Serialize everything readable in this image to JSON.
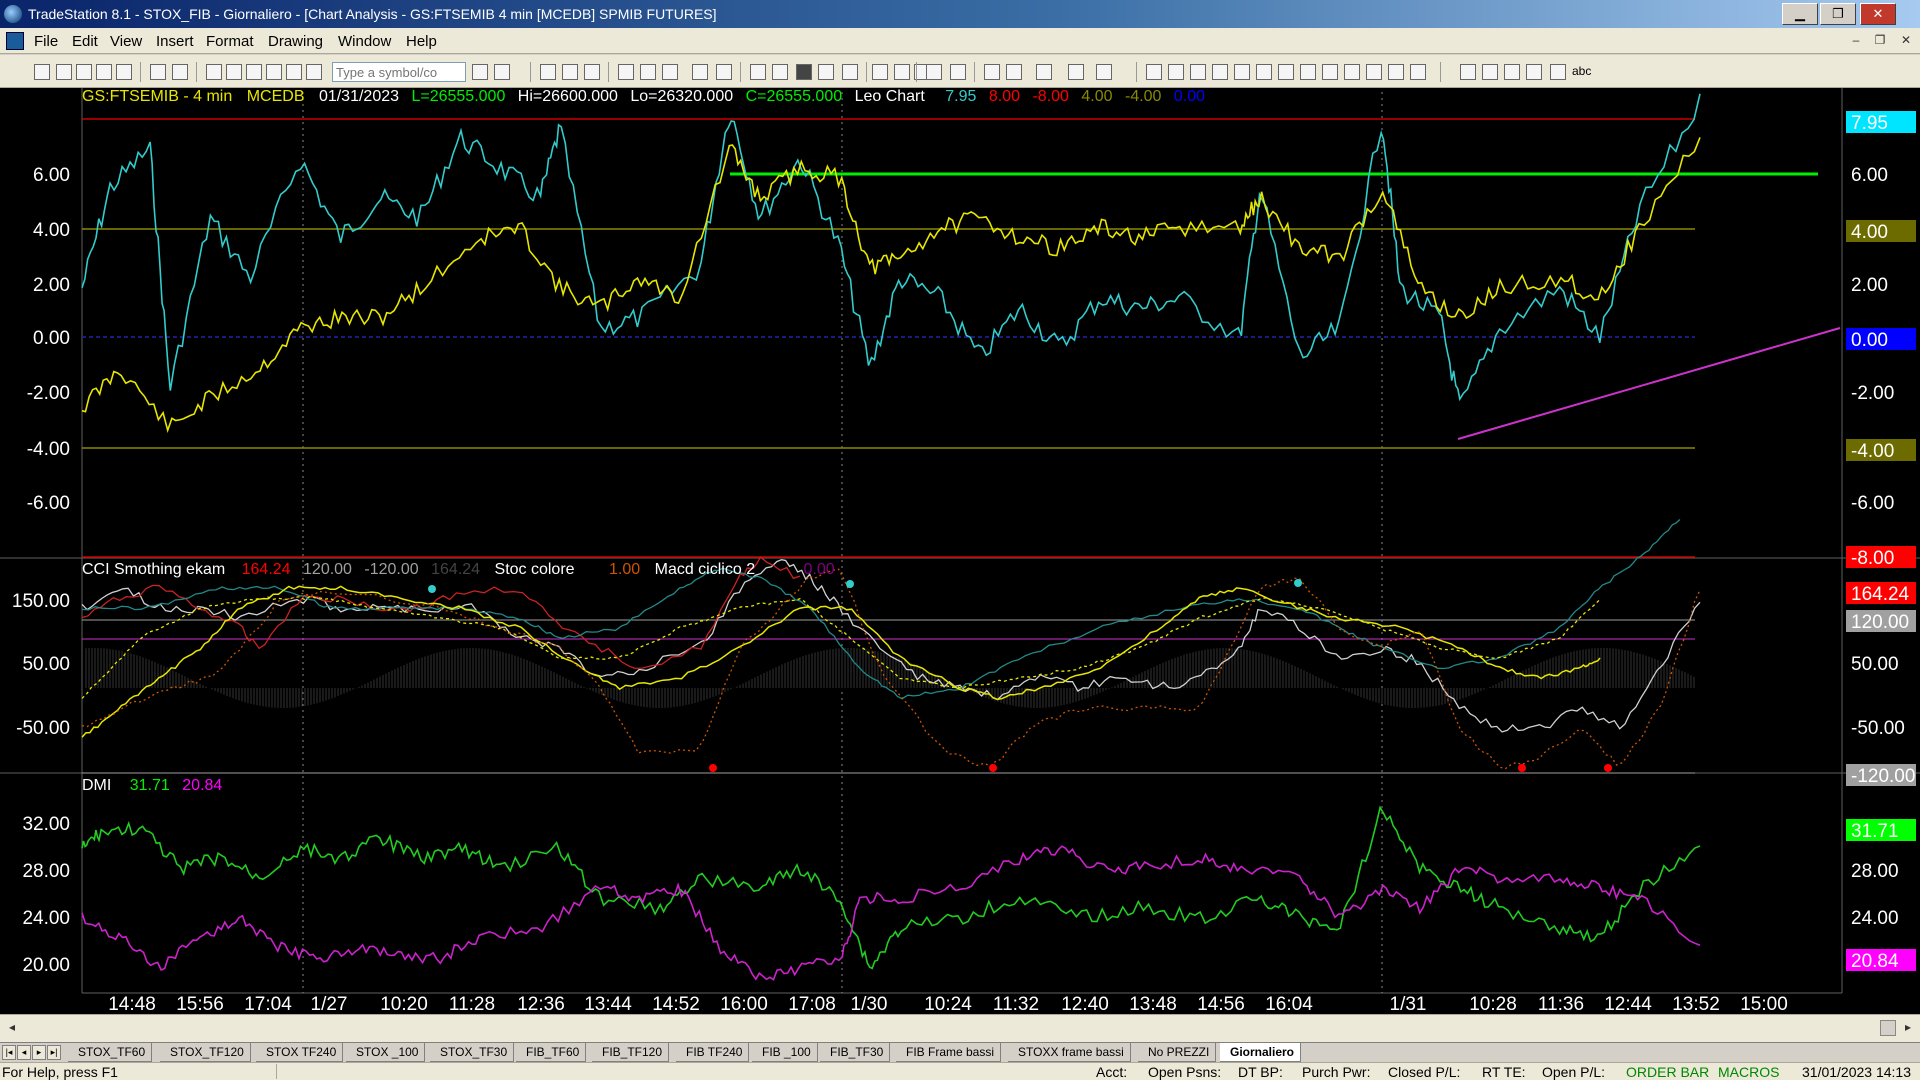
{
  "window": {
    "title": "TradeStation 8.1 - STOX_FIB - Giornaliero - [Chart Analysis - GS:FTSEMIB  4 min  [MCEDB] SPMIB FUTURES]",
    "minimize": "▁",
    "restore": "❐",
    "close": "✕"
  },
  "menu": {
    "items": [
      "File",
      "Edit",
      "View",
      "Insert",
      "Format",
      "Drawing",
      "Window",
      "Help"
    ],
    "mdi_minimize": "–",
    "mdi_restore": "❐",
    "mdi_close": "✕"
  },
  "toolbar": {
    "symbol_placeholder": "Type a symbol/co",
    "abc_label": "abc"
  },
  "chart": {
    "header": {
      "symbol": "GS:FTSEMIB - 4 min",
      "exchange": "MCEDB",
      "date": "01/31/2023",
      "last": "L=26555.000",
      "high": "Hi=26600.000",
      "low": "Lo=26320.000",
      "close": "C=26555.000",
      "indicator_name": "Leo Chart",
      "v1": "7.95",
      "v2": "8.00",
      "v3": "-8.00",
      "v4": "4.00",
      "v5": "-4.00",
      "v6": "0.00"
    },
    "cci_header": {
      "name": "CCI Smothing ekam",
      "v1": "164.24",
      "v2": "120.00",
      "v3": "-120.00",
      "v4": "164.24",
      "stoc_name": "Stoc colore",
      "stoc_val": "1.00",
      "macd_name": "Macd ciclico 2",
      "macd_val": "0.00"
    },
    "dmi_header": {
      "name": "DMI",
      "plus": "31.71",
      "minus": "20.84"
    },
    "panel1_axis": [
      "6.00",
      "4.00",
      "2.00",
      "0.00",
      "-2.00",
      "-4.00",
      "-6.00"
    ],
    "panel1_right_badges": [
      {
        "text": "7.95",
        "bg": "#00e5ff",
        "fg": "#000"
      },
      {
        "text": "6.00",
        "bg": "#000",
        "fg": "#fff"
      },
      {
        "text": "4.00",
        "bg": "#6b6b00",
        "fg": "#000"
      },
      {
        "text": "2.00",
        "bg": "#000",
        "fg": "#fff"
      },
      {
        "text": "0.00",
        "bg": "#0000ff",
        "fg": "#000"
      },
      {
        "text": "-2.00",
        "bg": "#000",
        "fg": "#fff"
      },
      {
        "text": "-4.00",
        "bg": "#6b6b00",
        "fg": "#000"
      },
      {
        "text": "-6.00",
        "bg": "#000",
        "fg": "#fff"
      },
      {
        "text": "-8.00",
        "bg": "#ff0000",
        "fg": "#000"
      }
    ],
    "panel2_axis": [
      "150.00",
      "50.00",
      "-50.00"
    ],
    "panel2_right_badges": [
      {
        "text": "164.24",
        "bg": "#ff0000",
        "fg": "#fff"
      },
      {
        "text": "120.00",
        "bg": "#a0a0a0",
        "fg": "#000"
      },
      {
        "text": "50.00",
        "bg": "#000",
        "fg": "#fff"
      },
      {
        "text": "-50.00",
        "bg": "#000",
        "fg": "#fff"
      },
      {
        "text": "-120.00",
        "bg": "#a0a0a0",
        "fg": "#000"
      }
    ],
    "panel3_axis": [
      "32.00",
      "28.00",
      "24.00",
      "20.00"
    ],
    "panel3_right_badges": [
      {
        "text": "31.71",
        "bg": "#00ff00",
        "fg": "#000"
      },
      {
        "text": "28.00",
        "bg": "#000",
        "fg": "#fff"
      },
      {
        "text": "24.00",
        "bg": "#000",
        "fg": "#fff"
      },
      {
        "text": "20.84",
        "bg": "#ff00ff",
        "fg": "#000"
      }
    ],
    "time_labels": [
      "14:48",
      "15:56",
      "17:04",
      "1/27",
      "10:20",
      "11:28",
      "12:36",
      "13:44",
      "14:52",
      "16:00",
      "17:08",
      "1/30",
      "10:24",
      "11:32",
      "12:40",
      "13:48",
      "14:56",
      "16:04",
      "1/31",
      "10:28",
      "11:36",
      "12:44",
      "13:52",
      "15:00"
    ],
    "colors": {
      "cyan": "#33cccc",
      "yellow": "#e6e600",
      "green_level": "#00ee00",
      "magenta": "#cc33cc",
      "red": "#cc0000",
      "dmi_plus": "#22cc22",
      "dmi_minus": "#cc22cc"
    }
  },
  "tabs": {
    "items": [
      "STOX_TF60",
      "STOX_TF120",
      "STOX TF240",
      "STOX _100",
      "STOX_TF30",
      "FIB_TF60",
      "FIB_TF120",
      "FIB TF240",
      "FIB _100",
      "FIB_TF30",
      "FIB Frame bassi",
      "STOXX frame bassi",
      "No PREZZI",
      "Giornaliero"
    ],
    "active": "Giornaliero"
  },
  "status": {
    "help": "For Help, press F1",
    "acct": "Acct:",
    "open_psns": "Open Psns:",
    "dt_bp": "DT BP:",
    "purch_pwr": "Purch Pwr:",
    "closed_pl": "Closed P/L:",
    "rt_te": "RT TE:",
    "open_pl": "Open P/L:",
    "order_bar": "ORDER BAR",
    "macros": "MACROS",
    "datetime": "31/01/2023 14:13"
  }
}
